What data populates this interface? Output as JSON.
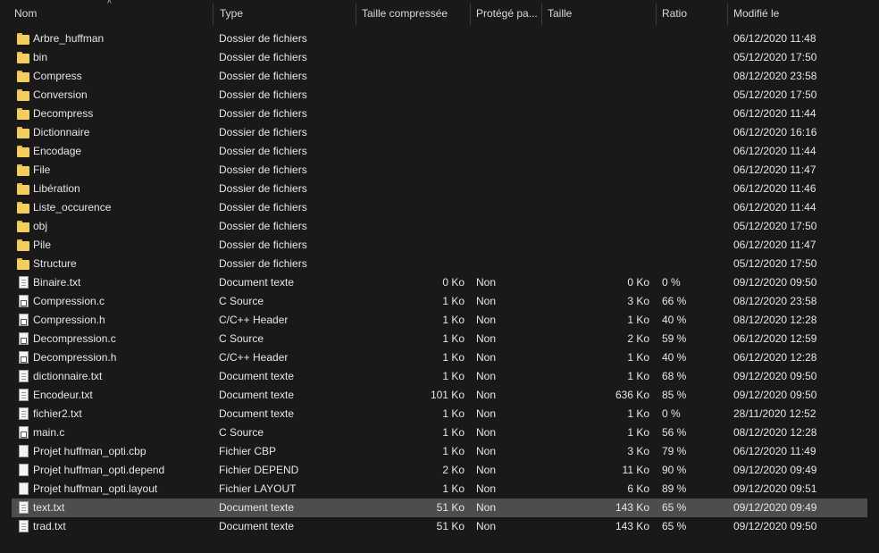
{
  "columns": {
    "name": "Nom",
    "type": "Type",
    "compressed_size": "Taille compressée",
    "protected": "Protégé pa...",
    "size": "Taille",
    "ratio": "Ratio",
    "modified": "Modifié le"
  },
  "sort_indicator": "^",
  "files": [
    {
      "icon": "folder-icon",
      "name": "Arbre_huffman",
      "type": "Dossier de fichiers",
      "csize": "",
      "prot": "",
      "size": "",
      "ratio": "",
      "date": "06/12/2020 11:48"
    },
    {
      "icon": "folder-icon",
      "name": "bin",
      "type": "Dossier de fichiers",
      "csize": "",
      "prot": "",
      "size": "",
      "ratio": "",
      "date": "05/12/2020 17:50"
    },
    {
      "icon": "folder-icon",
      "name": "Compress",
      "type": "Dossier de fichiers",
      "csize": "",
      "prot": "",
      "size": "",
      "ratio": "",
      "date": "08/12/2020 23:58"
    },
    {
      "icon": "folder-icon",
      "name": "Conversion",
      "type": "Dossier de fichiers",
      "csize": "",
      "prot": "",
      "size": "",
      "ratio": "",
      "date": "05/12/2020 17:50"
    },
    {
      "icon": "folder-icon",
      "name": "Decompress",
      "type": "Dossier de fichiers",
      "csize": "",
      "prot": "",
      "size": "",
      "ratio": "",
      "date": "06/12/2020 11:44"
    },
    {
      "icon": "folder-icon",
      "name": "Dictionnaire",
      "type": "Dossier de fichiers",
      "csize": "",
      "prot": "",
      "size": "",
      "ratio": "",
      "date": "06/12/2020 16:16"
    },
    {
      "icon": "folder-icon",
      "name": "Encodage",
      "type": "Dossier de fichiers",
      "csize": "",
      "prot": "",
      "size": "",
      "ratio": "",
      "date": "06/12/2020 11:44"
    },
    {
      "icon": "folder-icon",
      "name": "File",
      "type": "Dossier de fichiers",
      "csize": "",
      "prot": "",
      "size": "",
      "ratio": "",
      "date": "06/12/2020 11:47"
    },
    {
      "icon": "folder-icon",
      "name": "Libération",
      "type": "Dossier de fichiers",
      "csize": "",
      "prot": "",
      "size": "",
      "ratio": "",
      "date": "06/12/2020 11:46"
    },
    {
      "icon": "folder-icon",
      "name": "Liste_occurence",
      "type": "Dossier de fichiers",
      "csize": "",
      "prot": "",
      "size": "",
      "ratio": "",
      "date": "06/12/2020 11:44"
    },
    {
      "icon": "folder-icon",
      "name": "obj",
      "type": "Dossier de fichiers",
      "csize": "",
      "prot": "",
      "size": "",
      "ratio": "",
      "date": "05/12/2020 17:50"
    },
    {
      "icon": "folder-icon",
      "name": "Pile",
      "type": "Dossier de fichiers",
      "csize": "",
      "prot": "",
      "size": "",
      "ratio": "",
      "date": "06/12/2020 11:47"
    },
    {
      "icon": "folder-icon",
      "name": "Structure",
      "type": "Dossier de fichiers",
      "csize": "",
      "prot": "",
      "size": "",
      "ratio": "",
      "date": "05/12/2020 17:50"
    },
    {
      "icon": "text-file-icon",
      "name": "Binaire.txt",
      "type": "Document texte",
      "csize": "0 Ko",
      "prot": "Non",
      "size": "0 Ko",
      "ratio": "0 %",
      "date": "09/12/2020 09:50"
    },
    {
      "icon": "c-source-file-icon",
      "name": "Compression.c",
      "type": "C Source",
      "csize": "1 Ko",
      "prot": "Non",
      "size": "3 Ko",
      "ratio": "66 %",
      "date": "08/12/2020 23:58"
    },
    {
      "icon": "c-source-file-icon",
      "name": "Compression.h",
      "type": "C/C++ Header",
      "csize": "1 Ko",
      "prot": "Non",
      "size": "1 Ko",
      "ratio": "40 %",
      "date": "08/12/2020 12:28"
    },
    {
      "icon": "c-source-file-icon",
      "name": "Decompression.c",
      "type": "C Source",
      "csize": "1 Ko",
      "prot": "Non",
      "size": "2 Ko",
      "ratio": "59 %",
      "date": "06/12/2020 12:59"
    },
    {
      "icon": "c-source-file-icon",
      "name": "Decompression.h",
      "type": "C/C++ Header",
      "csize": "1 Ko",
      "prot": "Non",
      "size": "1 Ko",
      "ratio": "40 %",
      "date": "06/12/2020 12:28"
    },
    {
      "icon": "text-file-icon",
      "name": "dictionnaire.txt",
      "type": "Document texte",
      "csize": "1 Ko",
      "prot": "Non",
      "size": "1 Ko",
      "ratio": "68 %",
      "date": "09/12/2020 09:50"
    },
    {
      "icon": "text-file-icon",
      "name": "Encodeur.txt",
      "type": "Document texte",
      "csize": "101 Ko",
      "prot": "Non",
      "size": "636 Ko",
      "ratio": "85 %",
      "date": "09/12/2020 09:50"
    },
    {
      "icon": "text-file-icon",
      "name": "fichier2.txt",
      "type": "Document texte",
      "csize": "1 Ko",
      "prot": "Non",
      "size": "1 Ko",
      "ratio": "0 %",
      "date": "28/11/2020 12:52"
    },
    {
      "icon": "c-source-file-icon",
      "name": "main.c",
      "type": "C Source",
      "csize": "1 Ko",
      "prot": "Non",
      "size": "1 Ko",
      "ratio": "56 %",
      "date": "08/12/2020 12:28"
    },
    {
      "icon": "blank-file-icon",
      "name": "Projet huffman_opti.cbp",
      "type": "Fichier CBP",
      "csize": "1 Ko",
      "prot": "Non",
      "size": "3 Ko",
      "ratio": "79 %",
      "date": "06/12/2020 11:49"
    },
    {
      "icon": "blank-file-icon",
      "name": "Projet huffman_opti.depend",
      "type": "Fichier DEPEND",
      "csize": "2 Ko",
      "prot": "Non",
      "size": "11 Ko",
      "ratio": "90 %",
      "date": "09/12/2020 09:49"
    },
    {
      "icon": "blank-file-icon",
      "name": "Projet huffman_opti.layout",
      "type": "Fichier LAYOUT",
      "csize": "1 Ko",
      "prot": "Non",
      "size": "6 Ko",
      "ratio": "89 %",
      "date": "09/12/2020 09:51"
    },
    {
      "icon": "text-file-icon",
      "name": "text.txt",
      "type": "Document texte",
      "csize": "51 Ko",
      "prot": "Non",
      "size": "143 Ko",
      "ratio": "65 %",
      "date": "09/12/2020 09:49",
      "selected": true
    },
    {
      "icon": "text-file-icon",
      "name": "trad.txt",
      "type": "Document texte",
      "csize": "51 Ko",
      "prot": "Non",
      "size": "143 Ko",
      "ratio": "65 %",
      "date": "09/12/2020 09:50"
    }
  ],
  "colors": {
    "background": "#191919",
    "text": "#e6e6e6",
    "selection": "#4d4d4d",
    "folder": "#f3cd5d"
  }
}
